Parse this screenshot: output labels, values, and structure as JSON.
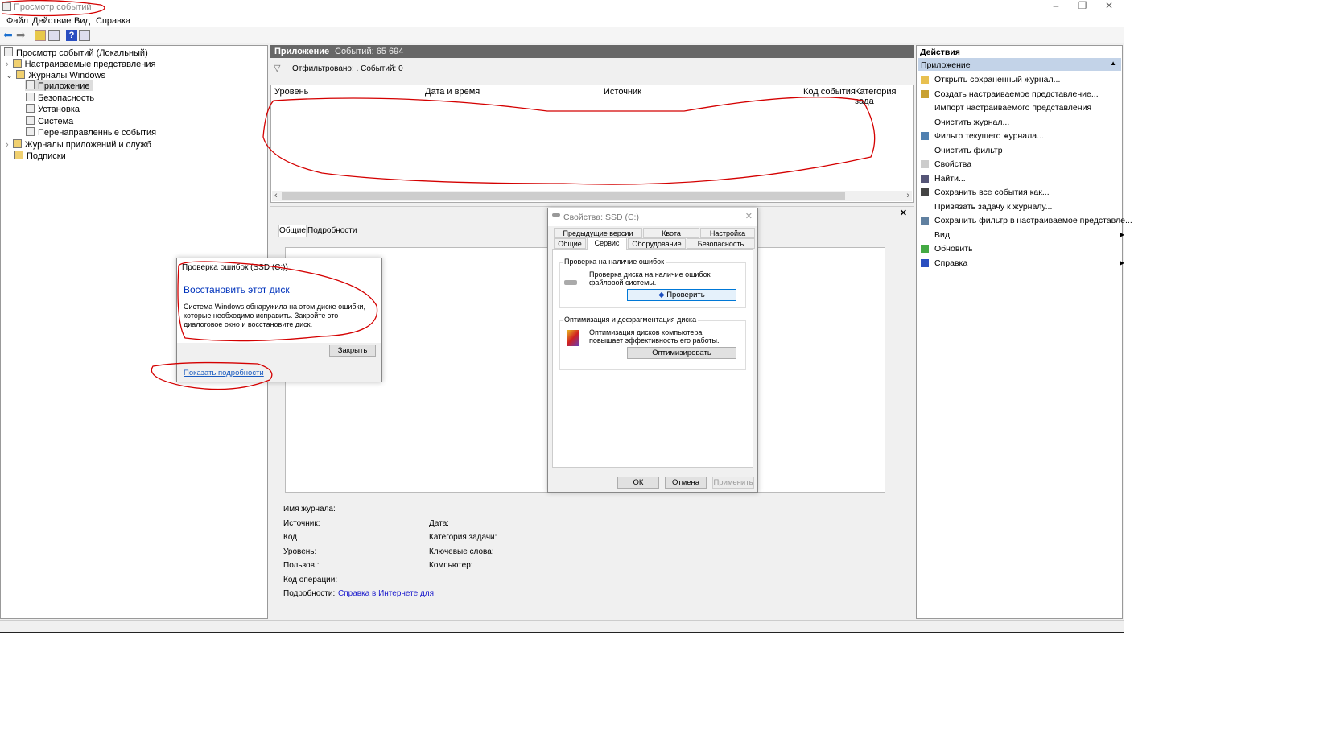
{
  "window": {
    "title": "Просмотр событий",
    "controls": [
      "minimize",
      "restore",
      "close"
    ]
  },
  "menu": [
    "Файл",
    "Действие",
    "Вид",
    "Справка"
  ],
  "toolbar": [
    "back-icon",
    "forward-icon",
    "open-folder-icon",
    "console-tree-icon",
    "help-icon",
    "action-pane-icon"
  ],
  "tree": {
    "root": "Просмотр событий (Локальный)",
    "items": [
      {
        "label": "Настраиваемые представления",
        "level": 1,
        "expander": ">"
      },
      {
        "label": "Журналы Windows",
        "level": 1,
        "expander": "v"
      },
      {
        "label": "Приложение",
        "level": 2,
        "selected": true
      },
      {
        "label": "Безопасность",
        "level": 2
      },
      {
        "label": "Установка",
        "level": 2
      },
      {
        "label": "Система",
        "level": 2
      },
      {
        "label": "Перенаправленные события",
        "level": 2
      },
      {
        "label": "Журналы приложений и служб",
        "level": 1,
        "expander": ">"
      },
      {
        "label": "Подписки",
        "level": 1
      }
    ]
  },
  "center": {
    "header_title": "Приложение",
    "header_count": "Событий: 65 694",
    "filter": "Отфильтровано: . Событий: 0",
    "columns": [
      "Уровень",
      "Дата и время",
      "Источник",
      "Код события",
      "Категория зада"
    ],
    "detail_tabs": [
      "Общие",
      "Подробности"
    ],
    "fields": {
      "log_name": "Имя журнала:",
      "source": "Источник:",
      "code": "Код",
      "level": "Уровень:",
      "user": "Пользов.:",
      "opcode": "Код операции:",
      "details": "Подробности:",
      "details_link": "Справка в Интернете для",
      "date": "Дата:",
      "task_category": "Категория задачи:",
      "keywords": "Ключевые слова:",
      "computer": "Компьютер:"
    }
  },
  "actions": {
    "title": "Действия",
    "section": "Приложение",
    "items": [
      "Открыть сохраненный журнал...",
      "Создать настраиваемое представление...",
      "Импорт настраиваемого представления",
      "Очистить журнал...",
      "Фильтр текущего журнала...",
      "Очистить фильтр",
      "Свойства",
      "Найти...",
      "Сохранить все события как...",
      "Привязать задачу к журналу...",
      "Сохранить фильтр в настраиваемое представле...",
      "Вид",
      "Обновить",
      "Справка"
    ]
  },
  "props": {
    "title": "Свойства: SSD (C:)",
    "tabs_row1": [
      "Предыдущие версии",
      "Квота",
      "Настройка"
    ],
    "tabs_row2": [
      "Общие",
      "Сервис",
      "Оборудование",
      "Безопасность"
    ],
    "check_group": "Проверка на наличие ошибок",
    "check_text": "Проверка диска на наличие ошибок файловой системы.",
    "check_btn": "Проверить",
    "opt_group": "Оптимизация и дефрагментация диска",
    "opt_text": "Оптимизация дисков компьютера повышает эффективность его работы.",
    "opt_btn": "Оптимизировать",
    "ok": "ОК",
    "cancel": "Отмена",
    "apply": "Применить"
  },
  "errdlg": {
    "title": "Проверка ошибок (SSD (C:))",
    "heading": "Восстановить этот диск",
    "body": "Система Windows обнаружила на этом диске ошибки, которые необходимо исправить. Закройте это диалоговое окно и восстановите диск.",
    "close": "Закрыть",
    "details_link": "Показать подробности"
  },
  "colors": {
    "accent": "#0033bc",
    "header": "#676767",
    "annotation": "#d40000",
    "selected": "#cce8ff"
  }
}
